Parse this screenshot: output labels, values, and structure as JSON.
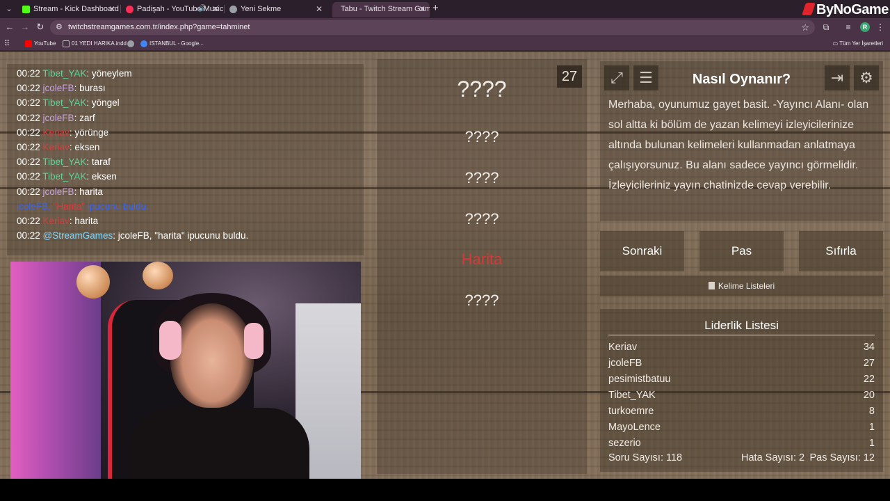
{
  "browser": {
    "tabs": [
      {
        "title": "Stream - Kick Dashboard",
        "favicon_color": "#53fc18"
      },
      {
        "title": "Padişah - YouTube Music",
        "favicon_color": "#ff2d55"
      },
      {
        "title": "Yeni Sekme",
        "favicon_color": "#9aa0a6"
      },
      {
        "title": "Tabu - Twitch Stream Games",
        "favicon_color": ""
      }
    ],
    "url": "twitchstreamgames.com.tr/index.php?game=tahminet",
    "bookmarks": [
      {
        "label": "YouTube",
        "color": "#ff0000"
      },
      {
        "label": "01 YEDI HARIKA.indd",
        "color": ""
      },
      {
        "label": "",
        "color": "#9aa0a6"
      },
      {
        "label": "ISTANBUL - Google...",
        "color": "#4285f4"
      }
    ],
    "bookmarks_right": "Tüm Yer İşaretleri",
    "avatar_letter": "R",
    "brand": "ByNoGame"
  },
  "chat": [
    {
      "time": "00:22",
      "user": "Tibet_YAK",
      "utype": "tibet",
      "msg": ": yöneylem"
    },
    {
      "time": "00:22",
      "user": "jcoleFB",
      "utype": "jcole",
      "msg": ": burası"
    },
    {
      "time": "00:22",
      "user": "Tibet_YAK",
      "utype": "tibet",
      "msg": ": yöngel"
    },
    {
      "time": "00:22",
      "user": "jcoleFB",
      "utype": "jcole",
      "msg": ": zarf"
    },
    {
      "time": "00:22",
      "user": "Keriav",
      "utype": "keriav",
      "msg": ": yörünge"
    },
    {
      "time": "00:22",
      "user": "Keriav",
      "utype": "keriav",
      "msg": ": eksen"
    },
    {
      "time": "00:22",
      "user": "Tibet_YAK",
      "utype": "tibet",
      "msg": ": taraf"
    },
    {
      "time": "00:22",
      "user": "Tibet_YAK",
      "utype": "tibet",
      "msg": ": eksen"
    },
    {
      "time": "00:22",
      "user": "jcoleFB",
      "utype": "jcole",
      "msg": ": harita"
    },
    {
      "time": "",
      "user": "",
      "utype": "notice",
      "msg": "jcoleFB, \"Harita\" ipucunu buldu.",
      "notice_pre": "jcoleFB, ",
      "notice_word": "\"Harita\"",
      "notice_post": " ipucunu buldu."
    },
    {
      "time": "00:22",
      "user": "Keriav",
      "utype": "keriav",
      "msg": ": harita"
    },
    {
      "time": "00:22",
      "user": "@StreamGames",
      "utype": "stream",
      "msg": ": jcoleFB, \"harita\" ipucunu buldu."
    }
  ],
  "game": {
    "timer": "27",
    "words": [
      {
        "text": "????",
        "found": false,
        "main": true
      },
      {
        "text": "????",
        "found": false,
        "main": false
      },
      {
        "text": "????",
        "found": false,
        "main": false
      },
      {
        "text": "????",
        "found": false,
        "main": false
      },
      {
        "text": "Harita",
        "found": true,
        "main": false
      },
      {
        "text": "????",
        "found": false,
        "main": false
      }
    ]
  },
  "howto": {
    "title": "Nasıl Oynanır?",
    "text": "Merhaba, oyunumuz gayet basit. -Yayıncı Alanı- olan sol altta ki bölüm de yazan kelimeyi izleyicilerinize altında bulunan kelimeleri kullanmadan anlatmaya çalışıyorsunuz. Bu alanı sadece yayıncı görmelidir. İzleyicileriniz yayın chatinizde cevap verebilir."
  },
  "actions": {
    "next": "Sonraki",
    "pass": "Pas",
    "reset": "Sıfırla",
    "word_lists": "Kelime Listeleri"
  },
  "leaderboard": {
    "title": "Liderlik Listesi",
    "rows": [
      {
        "name": "Keriav",
        "score": "34"
      },
      {
        "name": "jcoleFB",
        "score": "27"
      },
      {
        "name": "pesimistbatuu",
        "score": "22"
      },
      {
        "name": "Tibet_YAK",
        "score": "20"
      },
      {
        "name": "turkoemre",
        "score": "8"
      },
      {
        "name": "MayoLence",
        "score": "1"
      },
      {
        "name": "sezerio",
        "score": "1"
      }
    ]
  },
  "stats": {
    "questions": "Soru Sayısı: 118",
    "errors": "Hata Sayısı: 2",
    "passes": "Pas Sayısı: 12"
  }
}
